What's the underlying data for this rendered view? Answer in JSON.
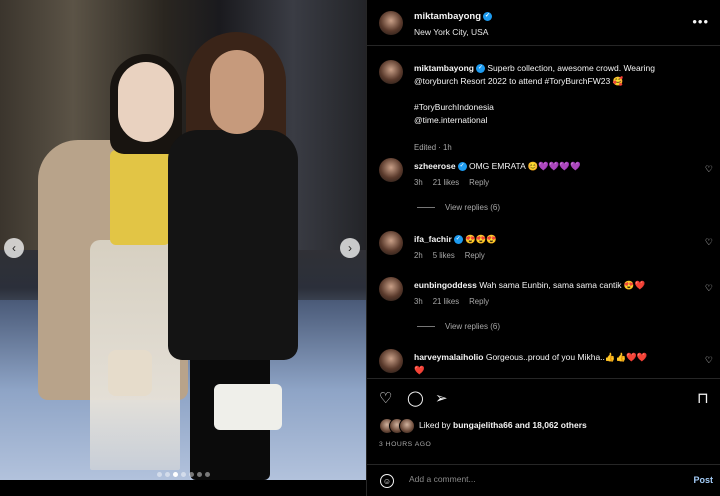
{
  "post": {
    "username": "miktambayong",
    "location": "New York City, USA",
    "caption_line1": "Superb collection, awesome crowd. Wearing",
    "caption_line2": "@toryburch Resort 2022 to attend #ToryBurchFW23 🥰",
    "caption_tag1": "#ToryBurchIndonesia",
    "caption_tag2": "@time.international",
    "caption_meta": "Edited · 1h",
    "likes_prefix": "Liked by",
    "likes_user": "bungajelitha66",
    "likes_suffix": "and 18,062 others",
    "time_ago": "3 HOURS AGO"
  },
  "photo": {
    "total_slides": 7,
    "active_slide": 3
  },
  "comments": [
    {
      "user": "szheerose",
      "verified": true,
      "text": "OMG EMRATA 😊💜💜💜💜",
      "time": "3h",
      "likes": "21 likes",
      "reply": "Reply",
      "view_replies": "View replies (6)"
    },
    {
      "user": "ifa_fachir",
      "verified": true,
      "text": "😍😍😍",
      "time": "2h",
      "likes": "5 likes",
      "reply": "Reply"
    },
    {
      "user": "eunbingoddess",
      "verified": false,
      "text": "Wah sama Eunbin, sama sama cantik 😍❤️",
      "time": "3h",
      "likes": "21 likes",
      "reply": "Reply",
      "view_replies": "View replies (6)"
    },
    {
      "user": "harveymalaiholio",
      "verified": false,
      "text": "Gorgeous..proud of you Mikha..👍👍❤️❤️",
      "text2": "❤️"
    }
  ],
  "add_comment": {
    "placeholder": "Add a comment...",
    "post_label": "Post"
  },
  "icons": {
    "more": "more-options-icon",
    "like": "heart-icon",
    "comment": "comment-icon",
    "share": "share-icon",
    "save": "bookmark-icon",
    "emoji": "emoji-icon"
  },
  "colors": {
    "background": "#000000",
    "verified": "#1d9bf0",
    "post_button": "#a4cdf8"
  }
}
